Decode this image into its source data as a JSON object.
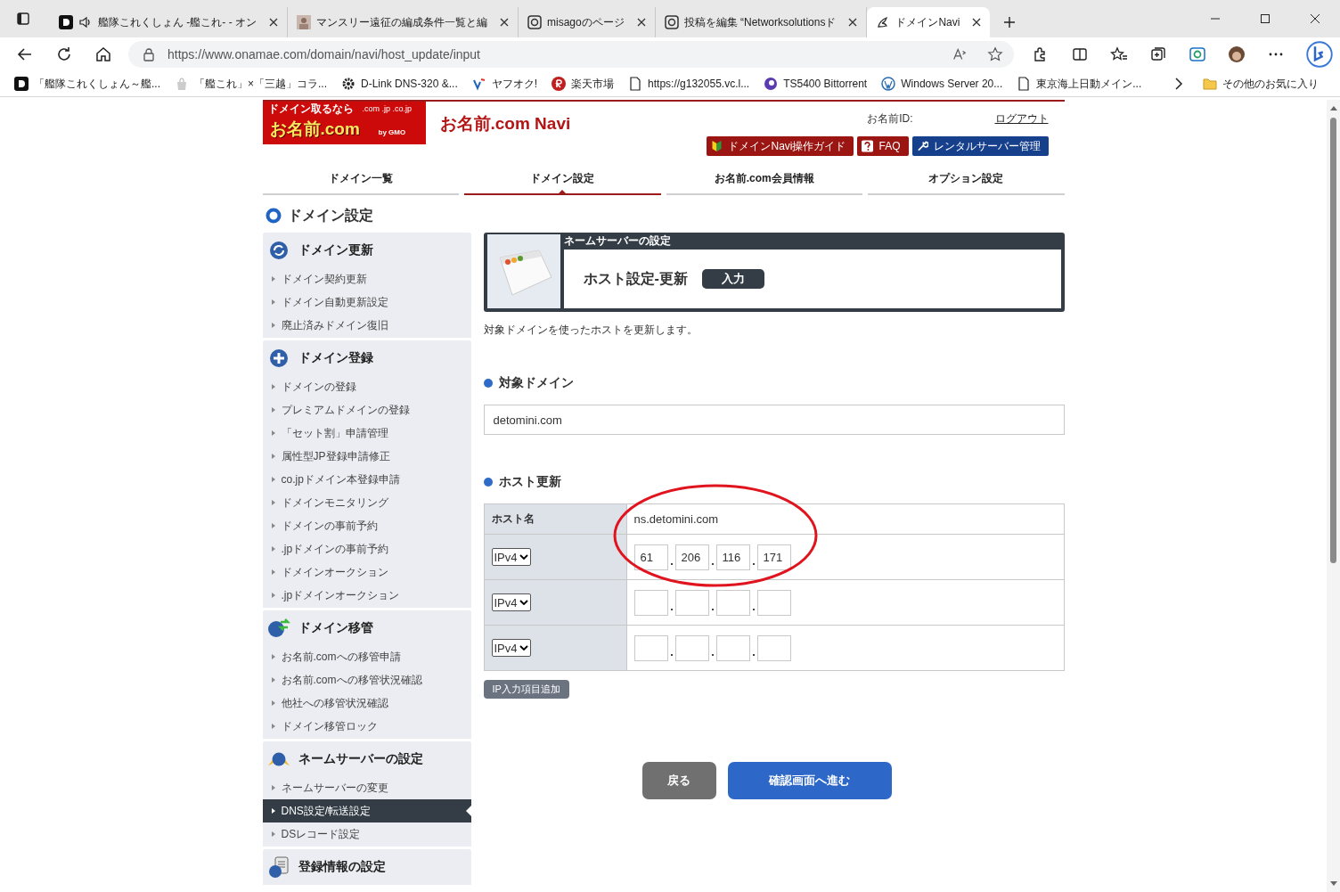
{
  "browser": {
    "tabs": [
      {
        "title": "艦隊これくしょん -艦これ- - オン",
        "kind": "dlogo",
        "audio": true,
        "selected": false
      },
      {
        "title": "マンスリー遠征の編成条件一覧と編",
        "kind": "photo",
        "audio": false,
        "selected": false
      },
      {
        "title": "misagoのページ",
        "kind": "elogo",
        "audio": false,
        "selected": false
      },
      {
        "title": "投稿を編集 “Networksolutionsド",
        "kind": "elogo",
        "audio": false,
        "selected": false
      },
      {
        "title": "ドメインNavi",
        "kind": "bird",
        "audio": false,
        "selected": true
      }
    ],
    "address": {
      "url": "https://www.onamae.com/domain/navi/host_update/input"
    },
    "bookmarks": [
      {
        "label": "「艦隊これくしょん～艦...",
        "kind": "dlogo"
      },
      {
        "label": "「艦これ」×「三越」コラ...",
        "kind": "bag"
      },
      {
        "label": "D-Link DNS-320 &...",
        "kind": "gear"
      },
      {
        "label": "ヤフオク!",
        "kind": "vlogo"
      },
      {
        "label": "楽天市場",
        "kind": "rlogo"
      },
      {
        "label": "https://g132055.vc.l...",
        "kind": "page"
      },
      {
        "label": "TS5400 Bittorrent",
        "kind": "swirl"
      },
      {
        "label": "Windows Server 20...",
        "kind": "wp"
      },
      {
        "label": "東京海上日動メイン...",
        "kind": "page"
      }
    ],
    "other_favorites": "その他のお気に入り"
  },
  "header": {
    "logo": {
      "tagline": "ドメイン取るなら",
      "name": "お名前.com",
      "tlds": ".com .jp .co.jp",
      "by": "by GMO"
    },
    "site_title": "お名前.com Navi",
    "member_id_label": "お名前ID:",
    "logout": "ログアウト",
    "buttons": [
      {
        "label": "ドメインNavi操作ガイド",
        "kind": "guide"
      },
      {
        "label": "FAQ",
        "kind": "faq"
      },
      {
        "label": "レンタルサーバー管理",
        "kind": "server"
      }
    ]
  },
  "nav_tabs": [
    {
      "label": "ドメイン一覧",
      "selected": false
    },
    {
      "label": "ドメイン設定",
      "selected": true
    },
    {
      "label": "お名前.com会員情報",
      "selected": false
    },
    {
      "label": "オプション設定",
      "selected": false
    }
  ],
  "page_heading": "ドメイン設定",
  "sidebar": {
    "sections": [
      {
        "title": "ドメイン更新",
        "kind": "renew",
        "items": [
          {
            "label": "ドメイン契約更新",
            "selected": false
          },
          {
            "label": "ドメイン自動更新設定",
            "selected": false
          },
          {
            "label": "廃止済みドメイン復旧",
            "selected": false
          }
        ]
      },
      {
        "title": "ドメイン登録",
        "kind": "add",
        "items": [
          {
            "label": "ドメインの登録",
            "selected": false
          },
          {
            "label": "プレミアムドメインの登録",
            "selected": false
          },
          {
            "label": "「セット割」申請管理",
            "selected": false
          },
          {
            "label": "属性型JP登録申請修正",
            "selected": false
          },
          {
            "label": "co.jpドメイン本登録申請",
            "selected": false
          },
          {
            "label": "ドメインモニタリング",
            "selected": false
          },
          {
            "label": "ドメインの事前予約",
            "selected": false
          },
          {
            "label": ".jpドメインの事前予約",
            "selected": false
          },
          {
            "label": "ドメインオークション",
            "selected": false
          },
          {
            "label": ".jpドメインオークション",
            "selected": false
          }
        ]
      },
      {
        "title": "ドメイン移管",
        "kind": "transfer",
        "items": [
          {
            "label": "お名前.comへの移管申請",
            "selected": false
          },
          {
            "label": "お名前.comへの移管状況確認",
            "selected": false
          },
          {
            "label": "他社への移管状況確認",
            "selected": false
          },
          {
            "label": "ドメイン移管ロック",
            "selected": false
          }
        ]
      },
      {
        "title": "ネームサーバーの設定",
        "kind": "nameserver",
        "items": [
          {
            "label": "ネームサーバーの変更",
            "selected": false
          },
          {
            "label": "DNS設定/転送設定",
            "selected": true
          },
          {
            "label": "DSレコード設定",
            "selected": false
          }
        ]
      },
      {
        "title": "登録情報の設定",
        "kind": "registry"
      }
    ]
  },
  "main": {
    "panel": {
      "category": "ネームサーバーの設定",
      "title": "ホスト設定-更新",
      "step": "入力"
    },
    "description": "対象ドメインを使ったホストを更新します。",
    "target_domain": {
      "heading": "対象ドメイン",
      "value": "detomini.com"
    },
    "host_update": {
      "heading": "ホスト更新",
      "host_label": "ホスト名",
      "host_name": "ns.detomini.com",
      "ip_rows": [
        {
          "type": "IPv4",
          "octets": [
            "61",
            "206",
            "116",
            "171"
          ]
        },
        {
          "type": "IPv4"
        },
        {
          "type": "IPv4"
        }
      ]
    },
    "add_button": "IP入力項目追加",
    "back_button": "戻る",
    "next_button": "確認画面へ進む"
  }
}
